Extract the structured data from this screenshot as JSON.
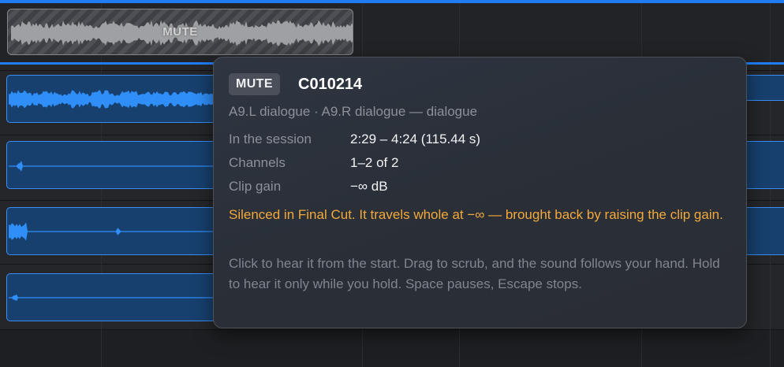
{
  "muted_clip": {
    "label": "MUTE"
  },
  "tooltip": {
    "badge": "MUTE",
    "clip_name": "C010214",
    "subtitle": "A9.L dialogue · A9.R dialogue  —  dialogue",
    "rows": [
      {
        "key": "In the session",
        "value": "2:29 – 4:24  (115.44 s)"
      },
      {
        "key": "Channels",
        "value": "1–2 of 2"
      },
      {
        "key": "Clip gain",
        "value": "−∞ dB"
      }
    ],
    "warning": "Silenced in Final Cut. It travels whole at −∞ — brought back by raising the clip gain.",
    "help": "Click to hear it from the start. Drag to scrub, and the sound follows your hand. Hold to hear it only while you hold. Space pauses, Escape stops."
  },
  "colors": {
    "accent": "#1f7cf2",
    "clip_fill": "#17406e",
    "warning": "#f3a93a",
    "muted_text": "#8b9099"
  }
}
